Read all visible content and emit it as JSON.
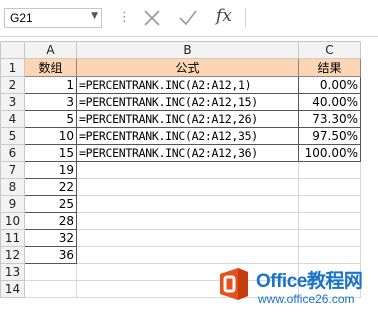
{
  "name_box": {
    "value": "G21"
  },
  "formula_bar": {
    "fx_label": "fx",
    "value": ""
  },
  "columns": [
    "A",
    "B",
    "C"
  ],
  "rows": [
    {
      "n": "1",
      "a": "数组",
      "b": "公式",
      "c": "结果"
    },
    {
      "n": "2",
      "a": "1",
      "b": "=PERCENTRANK.INC(A2:A12,1)",
      "c": "0.00%"
    },
    {
      "n": "3",
      "a": "3",
      "b": "=PERCENTRANK.INC(A2:A12,15)",
      "c": "40.00%"
    },
    {
      "n": "4",
      "a": "5",
      "b": "=PERCENTRANK.INC(A2:A12,26)",
      "c": "73.30%"
    },
    {
      "n": "5",
      "a": "10",
      "b": "=PERCENTRANK.INC(A2:A12,35)",
      "c": "97.50%"
    },
    {
      "n": "6",
      "a": "15",
      "b": "=PERCENTRANK.INC(A2:A12,36)",
      "c": "100.00%"
    },
    {
      "n": "7",
      "a": "19",
      "b": "",
      "c": ""
    },
    {
      "n": "8",
      "a": "22",
      "b": "",
      "c": ""
    },
    {
      "n": "9",
      "a": "25",
      "b": "",
      "c": ""
    },
    {
      "n": "10",
      "a": "28",
      "b": "",
      "c": ""
    },
    {
      "n": "11",
      "a": "32",
      "b": "",
      "c": ""
    },
    {
      "n": "12",
      "a": "36",
      "b": "",
      "c": ""
    },
    {
      "n": "13",
      "a": "",
      "b": "",
      "c": ""
    },
    {
      "n": "14",
      "a": "",
      "b": "",
      "c": ""
    }
  ],
  "watermark": {
    "title": "Office教程网",
    "url": "www.office26.com"
  },
  "colors": {
    "header_fill": "#fcd5b4",
    "watermark_blue": "#1a73c9",
    "logo_orange": "#e8501b"
  }
}
